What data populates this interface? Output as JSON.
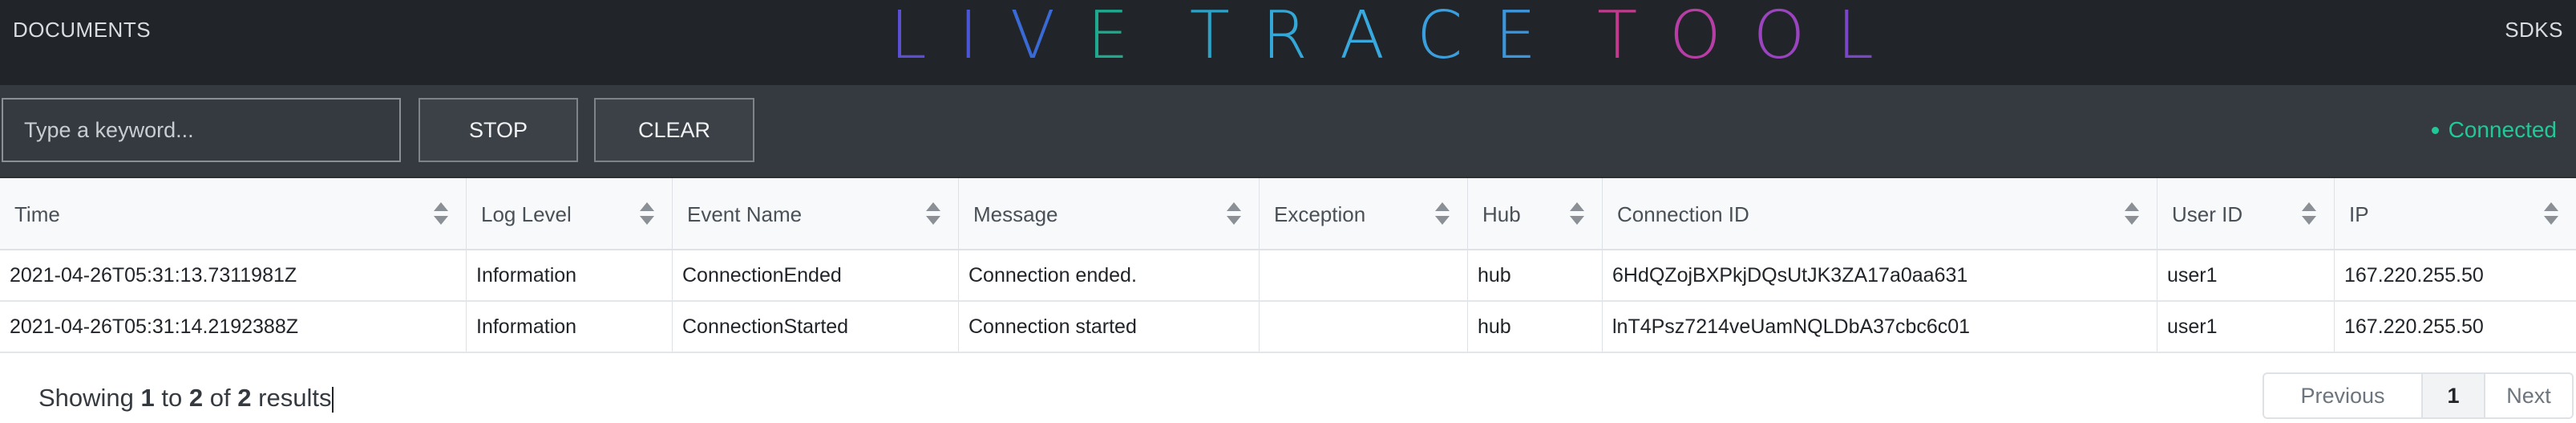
{
  "nav": {
    "documents": "DOCUMENTS",
    "sdks": "SDKS"
  },
  "brand": {
    "letters": [
      {
        "ch": "L",
        "color": "#5b4fd4"
      },
      {
        "ch": "I",
        "color": "#4a55d8"
      },
      {
        "ch": "V",
        "color": "#3a6ad6"
      },
      {
        "ch": "E",
        "color": "#1fa98e"
      },
      {
        "ch": " ",
        "color": "#212529"
      },
      {
        "ch": "T",
        "color": "#2aa3c9"
      },
      {
        "ch": "R",
        "color": "#33a8d8"
      },
      {
        "ch": "A",
        "color": "#38a9de"
      },
      {
        "ch": "C",
        "color": "#3a9fdf"
      },
      {
        "ch": "E",
        "color": "#3b96dd"
      },
      {
        "ch": " ",
        "color": "#212529"
      },
      {
        "ch": "T",
        "color": "#c2398d"
      },
      {
        "ch": "O",
        "color": "#b73ea4"
      },
      {
        "ch": "O",
        "color": "#9a44bf"
      },
      {
        "ch": "L",
        "color": "#7a47c9"
      }
    ]
  },
  "toolbar": {
    "search_placeholder": "Type a keyword...",
    "stop_label": "STOP",
    "clear_label": "CLEAR",
    "status_label": "Connected",
    "status_color": "#20c997"
  },
  "table": {
    "columns": [
      "Time",
      "Log Level",
      "Event Name",
      "Message",
      "Exception",
      "Hub",
      "Connection ID",
      "User ID",
      "IP"
    ],
    "rows": [
      [
        "2021-04-26T05:31:13.7311981Z",
        "Information",
        "ConnectionEnded",
        "Connection ended.",
        "",
        "hub",
        "6HdQZojBXPkjDQsUtJK3ZA17a0aa631",
        "user1",
        "167.220.255.50"
      ],
      [
        "2021-04-26T05:31:14.2192388Z",
        "Information",
        "ConnectionStarted",
        "Connection started",
        "",
        "hub",
        "lnT4Psz7214veUamNQLDbA37cbc6c01",
        "user1",
        "167.220.255.50"
      ]
    ]
  },
  "footer": {
    "showing": "Showing",
    "from": "1",
    "to_word": "to",
    "to": "2",
    "of_word": "of",
    "total": "2",
    "results": "results"
  },
  "pagination": {
    "previous": "Previous",
    "page": "1",
    "next": "Next"
  }
}
